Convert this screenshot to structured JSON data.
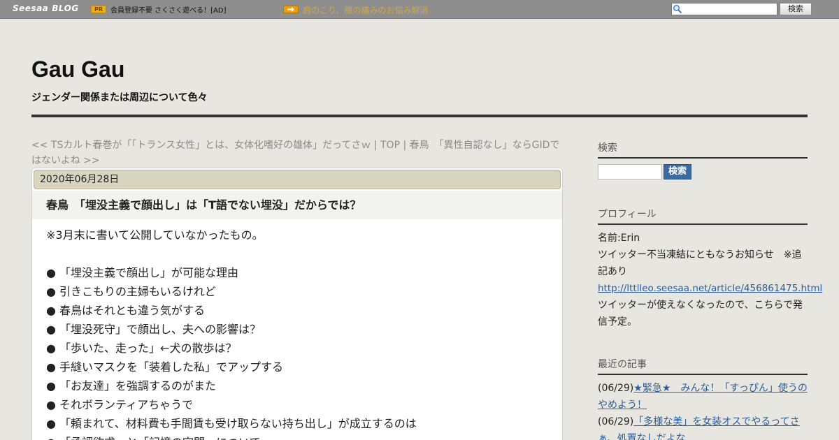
{
  "topbar": {
    "logo_main": "Seesaa",
    "logo_sub": "BLOG",
    "pr_badge": "PR",
    "pr_text": "会員登録不要 さくさく遊べる！[AD]",
    "ad_link": "肩のこり、腰の痛みのお悩み解消",
    "search_placeholder": "",
    "search_button": "検索"
  },
  "header": {
    "title": "Gau Gau",
    "description": "ジェンダー関係または周辺について色々"
  },
  "nav": {
    "prev": "<< TSカルト春巻が「「トランス女性」とは、女体化嗜好の雄体」だってさｗ",
    "sep1": " | ",
    "top": "TOP",
    "sep2": " | ",
    "next": "春鳥　「異性自認なし」ならGIDではないよね >>"
  },
  "article": {
    "date": "2020年06月28日",
    "title": "春鳥　「埋没主義で顔出し」は「T語でない埋没」だからでは？",
    "lines": [
      "※3月末に書いて公開していなかったもの。",
      "",
      "● 「埋没主義で顔出し」が可能な理由",
      "● 引きこもりの主婦もいるけれど",
      "● 春鳥はそれとも違う気がする",
      "● 「埋没死守」で顔出し、夫への影響は？",
      "● 「歩いた、走った」←犬の散歩は？",
      "● 手縫いマスクを「装着した私」でアップする",
      "● 「お友達」を強調するのがまた",
      "● それボランティアちゃうで",
      "● 「頼まれて、材料費も手間賃も受け取らない持ち出し」が成立するのは",
      "● 「承認欲求」と「記憶の空間」について"
    ]
  },
  "sidebar": {
    "search_heading": "検索",
    "search_button": "検索",
    "profile_heading": "プロフィール",
    "profile_name": "名前:Erin",
    "profile_notice": "ツイッター不当凍結にともなうお知らせ　※追記あり",
    "profile_link": "http://lttlleo.seesaa.net/article/456861475.html",
    "profile_after": "ツイッターが使えなくなったので、こちらで発信予定。",
    "recent_heading": "最近の記事",
    "recent": [
      {
        "date": "(06/29)",
        "title": "★緊急★　みんな！「すっぴん」使うのやめよう！"
      },
      {
        "date": "(06/29)",
        "title": "「多様な美」を女装オスでやるってさぁ、処置なしだよな"
      }
    ]
  }
}
